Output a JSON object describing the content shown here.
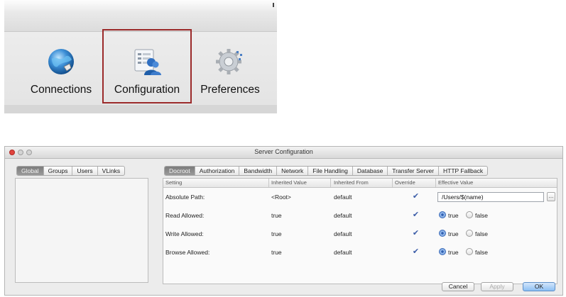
{
  "toolbar": {
    "items": [
      {
        "label": "Connections",
        "icon": "globe-icon"
      },
      {
        "label": "Configuration",
        "icon": "users-config-icon"
      },
      {
        "label": "Preferences",
        "icon": "gear-icon"
      }
    ],
    "selected": "Configuration",
    "highlight_color": "#9b2a2a"
  },
  "window": {
    "title": "Server Configuration",
    "left_tabs": [
      "Global",
      "Groups",
      "Users",
      "VLinks"
    ],
    "left_tabs_active": "Global",
    "main_tabs": [
      "Docroot",
      "Authorization",
      "Bandwidth",
      "Network",
      "File Handling",
      "Database",
      "Transfer Server",
      "HTTP Fallback"
    ],
    "main_tabs_active": "Docroot",
    "columns": [
      "Setting",
      "Inherited Value",
      "Inherited From",
      "Override",
      "Effective Value"
    ],
    "rows": [
      {
        "setting": "Absolute Path:",
        "inherited_value": "<Root>",
        "inherited_from": "default",
        "override": true,
        "effective_value": "/Users/$(name)",
        "more": "..."
      },
      {
        "setting": "Read Allowed:",
        "inherited_value": "true",
        "inherited_from": "default",
        "override": true,
        "radio_true": "true",
        "radio_false": "false",
        "selected": "true"
      },
      {
        "setting": "Write Allowed:",
        "inherited_value": "true",
        "inherited_from": "default",
        "override": true,
        "radio_true": "true",
        "radio_false": "false",
        "selected": "true"
      },
      {
        "setting": "Browse Allowed:",
        "inherited_value": "true",
        "inherited_from": "default",
        "override": true,
        "radio_true": "true",
        "radio_false": "false",
        "selected": "true"
      }
    ],
    "buttons": {
      "cancel": "Cancel",
      "apply": "Apply",
      "ok": "OK"
    },
    "checkmark": "✔"
  }
}
